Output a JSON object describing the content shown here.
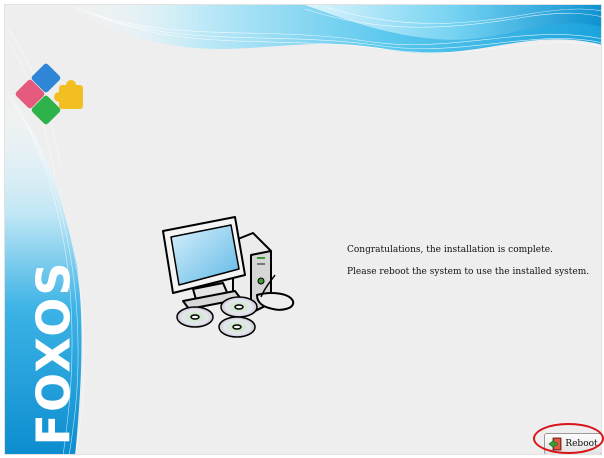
{
  "brand": {
    "name": "FOXOS",
    "logo_icon": "puzzle-pieces-icon",
    "accent": "#2aa6d8"
  },
  "illustration": {
    "icon": "computer-with-discs-icon"
  },
  "messages": {
    "line1": "Congratulations, the installation is complete.",
    "line2": "Please reboot the system to use the installed system."
  },
  "reboot_button": {
    "label": "Reboot",
    "icon": "reboot-icon",
    "highlight": "#d8141a"
  }
}
